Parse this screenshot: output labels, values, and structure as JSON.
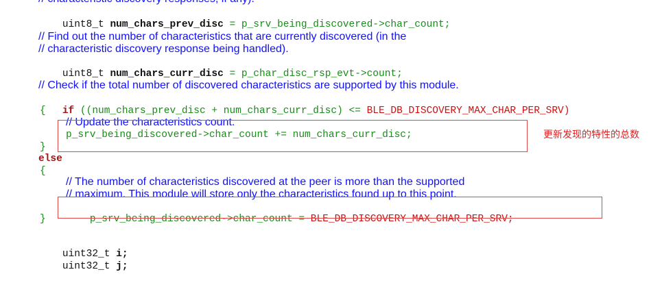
{
  "code": {
    "l1_comment": "// characteristic discovery responses, if any).",
    "l2_type": "uint8_t ",
    "l2_var": "num_chars_prev_disc",
    "l2_rest": " = p_srv_being_discovered->char_count;",
    "l3_comment": "// Find out the number of characteristics that are currently discovered (in the",
    "l4_comment": "// characteristic discovery response being handled).",
    "l5_type": "uint8_t ",
    "l5_var": "num_chars_curr_disc",
    "l5_rest": " = p_char_disc_rsp_evt->count;",
    "l6_comment": "// Check if the total number of discovered characteristics are supported by this module.",
    "l7_kw": "if",
    "l7_cond": " ((num_chars_prev_disc + num_chars_curr_disc) <= ",
    "l7_macro": "BLE_DB_DISCOVERY_MAX_CHAR_PER_SRV)",
    "open_brace": "{",
    "l9_comment": "// Update the characteristics count.",
    "l10_stmt": "p_srv_being_discovered->char_count += num_chars_curr_disc;",
    "close_brace": "}",
    "l12_kw": "else",
    "l14_comment": "// The number of characteristics discovered at the peer is more than the supported",
    "l15_comment": "// maximum. This module will store only the characteristics found up to this point.",
    "l16_stmt": "p_srv_being_discovered->char_count = ",
    "l16_macro": "BLE_DB_DISCOVERY_MAX_CHAR_PER_SRV;",
    "l18_type": "uint32_t ",
    "l18_var": "i;",
    "l19_type": "uint32_t ",
    "l19_var": "j;"
  },
  "annotation": {
    "text": "更新发现的特性的总数"
  },
  "colors": {
    "comment": "#1010ff",
    "keyword": "#a31515",
    "code": "#1a8a1a",
    "macro": "#d01010",
    "annotation_box": "#e04848"
  }
}
